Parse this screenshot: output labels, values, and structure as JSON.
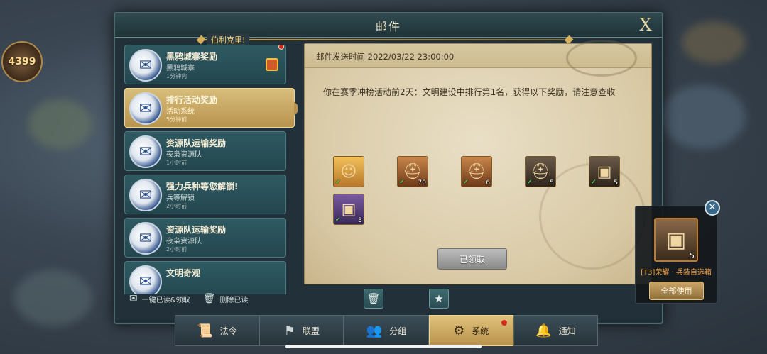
{
  "hud": {
    "score": "4399"
  },
  "window": {
    "title": "邮件",
    "close_label": "X",
    "ticker_text": "伯利克里!"
  },
  "mail_list": [
    {
      "title": "黑鸦城寨奖励",
      "subtitle": "黑鸦城寨",
      "time": "1分钟内",
      "unread": true,
      "has_gift": true
    },
    {
      "title": "排行活动奖励",
      "subtitle": "活动系统",
      "time": "5分钟前",
      "selected": true
    },
    {
      "title": "资源队运输奖励",
      "subtitle": "夜枭资源队",
      "time": "1小时前"
    },
    {
      "title": "强力兵种等您解锁!",
      "subtitle": "兵等解锁",
      "time": "2小时前"
    },
    {
      "title": "资源队运输奖励",
      "subtitle": "夜枭资源队",
      "time": "2小时前"
    },
    {
      "title": "文明奇观",
      "subtitle": "",
      "time": ""
    }
  ],
  "list_actions": {
    "read_claim_all": "一键已读&领取",
    "delete_read": "删除已读"
  },
  "content": {
    "send_time": "邮件发送时间 2022/03/22  23:00:00",
    "message": "你在赛季冲榜活动前2天：文明建设中排行第1名，获得以下奖励，请注意查收",
    "claimed_label": "已领取",
    "rewards": [
      {
        "icon": "hero-portrait-icon",
        "qty": ""
      },
      {
        "icon": "bronze-helmet-icon",
        "qty": "70"
      },
      {
        "icon": "bronze-helmet-icon",
        "qty": "6"
      },
      {
        "icon": "dark-helmet-icon",
        "qty": "5"
      },
      {
        "icon": "treasure-chest-icon",
        "qty": "5"
      },
      {
        "icon": "purple-chest-icon",
        "qty": "3"
      }
    ]
  },
  "tabs": [
    {
      "label": "法令",
      "icon": "scroll-icon"
    },
    {
      "label": "联盟",
      "icon": "banner-icon"
    },
    {
      "label": "分组",
      "icon": "group-icon"
    },
    {
      "label": "系统",
      "icon": "gear-icon",
      "active": true,
      "dot": true
    },
    {
      "label": "通知",
      "icon": "bell-icon"
    }
  ],
  "popup": {
    "item_qty": "5",
    "item_name": "[T3]荣耀 · 兵装自选箱",
    "use_all_label": "全部使用"
  },
  "colors": {
    "accent_gold": "#d8bd7a",
    "teal_panel": "#2f5a62",
    "unread_red": "#d32a1c"
  }
}
